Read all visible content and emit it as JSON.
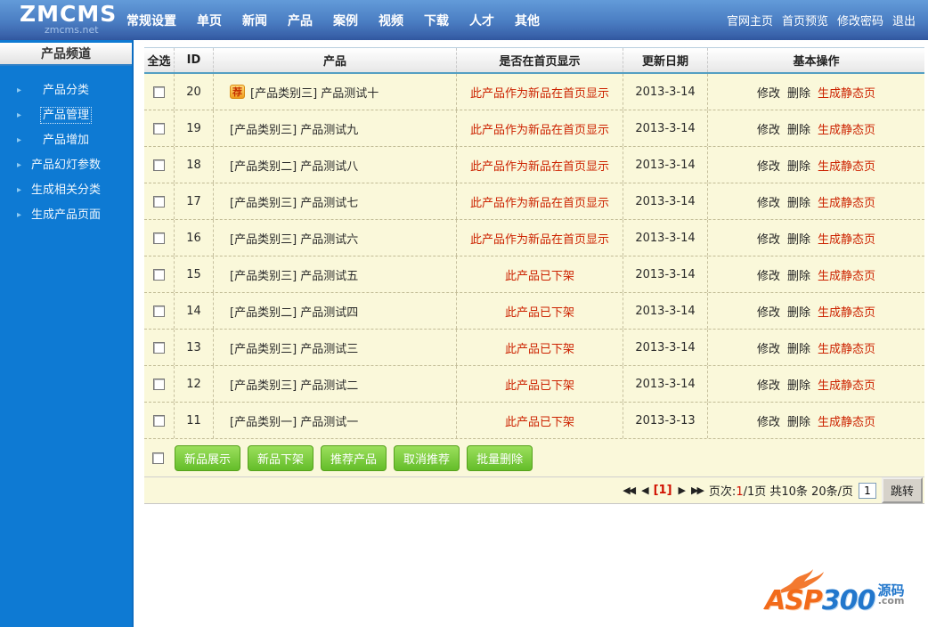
{
  "brand": {
    "logo": "ZMCMS",
    "domain": "zmcms.net"
  },
  "top_nav": {
    "items": [
      "常规设置",
      "单页",
      "新闻",
      "产品",
      "案例",
      "视频",
      "下载",
      "人才",
      "其他"
    ],
    "right_items": [
      "官网主页",
      "首页预览",
      "修改密码",
      "退出"
    ]
  },
  "sidebar": {
    "title": "产品频道",
    "items": [
      {
        "label": "产品分类",
        "active": false
      },
      {
        "label": "产品管理",
        "active": true
      },
      {
        "label": "产品增加",
        "active": false
      },
      {
        "label": "产品幻灯参数",
        "active": false
      },
      {
        "label": "生成相关分类",
        "active": false
      },
      {
        "label": "生成产品页面",
        "active": false
      }
    ]
  },
  "table": {
    "headers": [
      "全选",
      "ID",
      "产品",
      "是否在首页显示",
      "更新日期",
      "基本操作"
    ],
    "badge_char": "荐",
    "actions": {
      "modify": "修改",
      "delete": "删除",
      "generate": "生成静态页"
    },
    "rows": [
      {
        "id": "20",
        "badge": true,
        "product": "[产品类别三] 产品测试十",
        "status": "此产品作为新品在首页显示",
        "date": "2013-3-14"
      },
      {
        "id": "19",
        "badge": false,
        "product": "[产品类别三] 产品测试九",
        "status": "此产品作为新品在首页显示",
        "date": "2013-3-14"
      },
      {
        "id": "18",
        "badge": false,
        "product": "[产品类别二] 产品测试八",
        "status": "此产品作为新品在首页显示",
        "date": "2013-3-14"
      },
      {
        "id": "17",
        "badge": false,
        "product": "[产品类别三] 产品测试七",
        "status": "此产品作为新品在首页显示",
        "date": "2013-3-14"
      },
      {
        "id": "16",
        "badge": false,
        "product": "[产品类别三] 产品测试六",
        "status": "此产品作为新品在首页显示",
        "date": "2013-3-14"
      },
      {
        "id": "15",
        "badge": false,
        "product": "[产品类别三] 产品测试五",
        "status": "此产品已下架",
        "date": "2013-3-14"
      },
      {
        "id": "14",
        "badge": false,
        "product": "[产品类别二] 产品测试四",
        "status": "此产品已下架",
        "date": "2013-3-14"
      },
      {
        "id": "13",
        "badge": false,
        "product": "[产品类别三] 产品测试三",
        "status": "此产品已下架",
        "date": "2013-3-14"
      },
      {
        "id": "12",
        "badge": false,
        "product": "[产品类别三] 产品测试二",
        "status": "此产品已下架",
        "date": "2013-3-14"
      },
      {
        "id": "11",
        "badge": false,
        "product": "[产品类别一] 产品测试一",
        "status": "此产品已下架",
        "date": "2013-3-13"
      }
    ]
  },
  "bulk_buttons": [
    "新品展示",
    "新品下架",
    "推荐产品",
    "取消推荐",
    "批量删除"
  ],
  "pagination": {
    "first": "◀◀",
    "prev": "◀",
    "current_page": "[1]",
    "next": "▶",
    "last": "▶▶",
    "info_prefix": "页次:",
    "info_current": "1",
    "info_suffix": "/1页 共10条 20条/页",
    "jump_value": "1",
    "jump_label": "跳转"
  },
  "footer_logo": {
    "asp": "ASP",
    "num": "300",
    "yuanma": "源码",
    "com": ".com"
  },
  "colors": {
    "sidebar_blue": "#0e7ad3",
    "row_yellow": "#faf8da",
    "status_red": "#cc2200",
    "button_green": "#64bd29"
  }
}
